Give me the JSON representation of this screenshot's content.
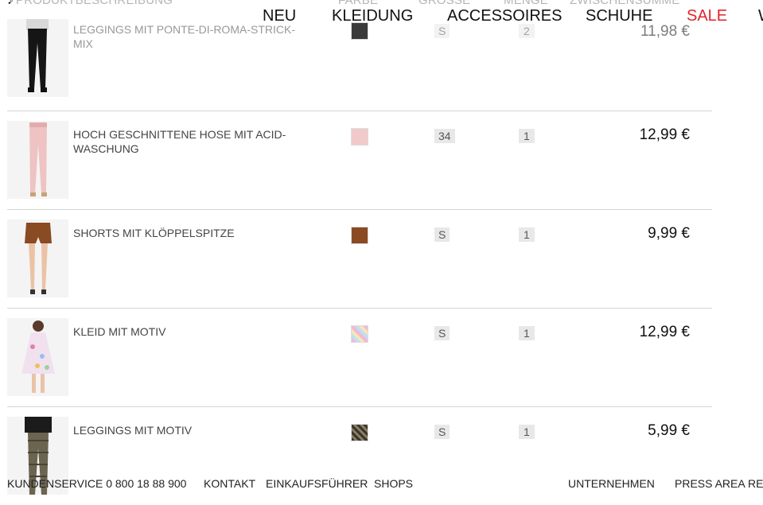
{
  "columns": {
    "description": "PRODUKTBESCHREIBUNG",
    "color": "FARBE",
    "size": "GRÖSSE",
    "quantity": "MENGE",
    "subtotal": "ZWISCHENSUMME"
  },
  "nav": [
    "NEU",
    "KLEIDUNG",
    "ACCESSOIRES",
    "SCHUHE",
    "SALE",
    "W"
  ],
  "items": [
    {
      "name": "LEGGINGS MIT PONTE-DI-ROMA-STRICK-MIX",
      "size": "S",
      "qty": "2",
      "price": "11,98 €",
      "swatch": "#3a3a3a"
    },
    {
      "name": "HOCH GESCHNITTENE HOSE MIT ACID-WASCHUNG",
      "size": "34",
      "qty": "1",
      "price": "12,99 €",
      "swatch": "#f2c9c9"
    },
    {
      "name": "SHORTS MIT KLÖPPELSPITZE",
      "size": "S",
      "qty": "1",
      "price": "9,99 €",
      "swatch": "#8a4a22"
    },
    {
      "name": "KLEID MIT MOTIV",
      "size": "S",
      "qty": "1",
      "price": "12,99 €",
      "swatch": "#e9d5ea"
    },
    {
      "name": "LEGGINGS MIT MOTIV",
      "size": "S",
      "qty": "1",
      "price": "5,99 €",
      "swatch": "#5b5241"
    }
  ],
  "footer": {
    "service": "KUNDENSERVICE 0 800 18 88 900",
    "contact": "KONTAKT",
    "guide": "EINKAUFSFÜHRER",
    "shops": "SHOPS",
    "company": "UNTERNEHMEN",
    "press": "PRESS AREA",
    "cut": "REG"
  }
}
